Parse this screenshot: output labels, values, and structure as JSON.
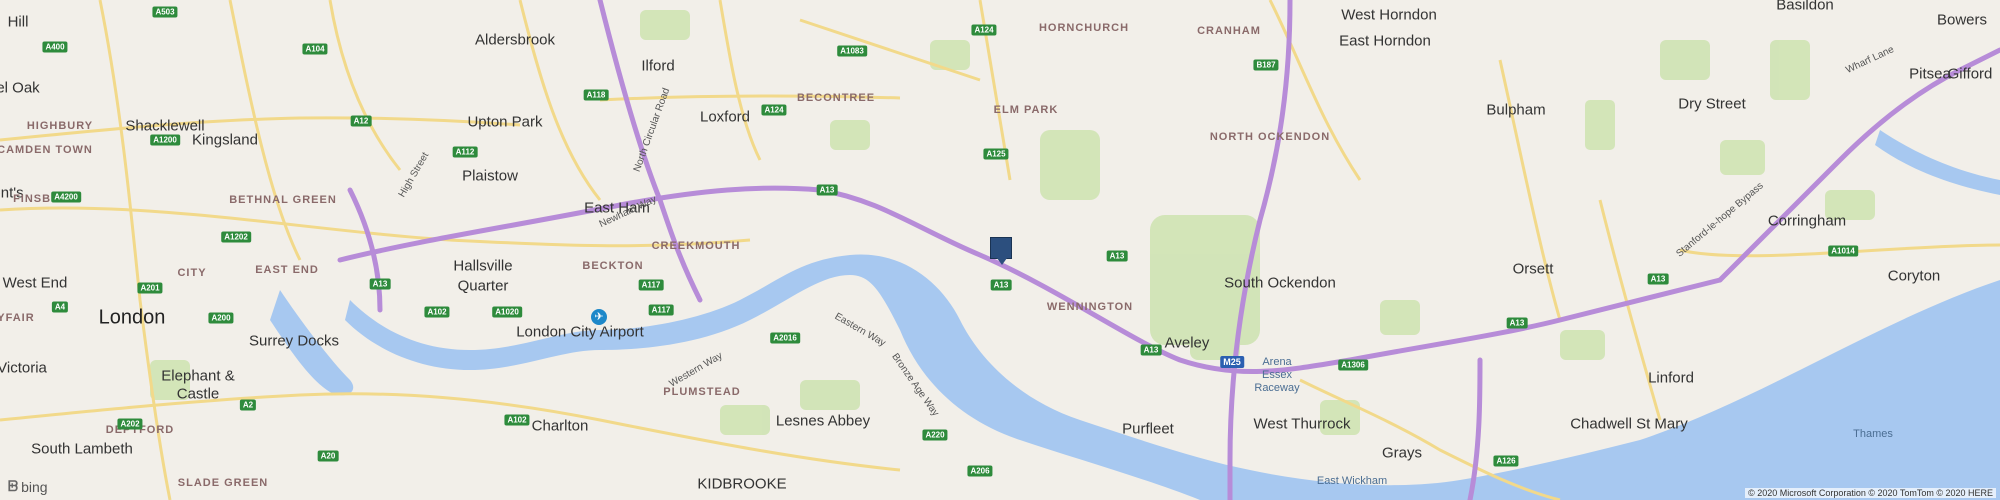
{
  "colors": {
    "land": "#f2efe9",
    "water": "#a7c8f0",
    "park": "#cfe3b3",
    "motorway": "#b78cd8",
    "primary_road": "#f2d98a",
    "pin": "#2c4f7e"
  },
  "pin": {
    "icon": "map-pin-square-icon"
  },
  "airport": {
    "icon": "airport-plane-icon",
    "glyph": "✈"
  },
  "places": [
    "Hill",
    "el Oak",
    "HIGHBURY",
    "Shacklewell",
    "Aldersbrook",
    "Ilford",
    "HORNCHURCH",
    "CRANHAM",
    "West Horndon",
    "East Horndon",
    "Basildon",
    "Bowers",
    "Gifford",
    "Pitsea",
    "CAMDEN TOWN",
    "Kingsland",
    "Upton Park",
    "Loxford",
    "BECONTREE",
    "ELM PARK",
    "NORTH OCKENDON",
    "Bulpham",
    "Dry Street",
    "ent's",
    "FINSBURY",
    "BETHNAL GREEN",
    "Plaistow",
    "East Ham",
    "CREEKMOUTH",
    "Corringham",
    "West End",
    "CITY",
    "EAST END",
    "Hallsville",
    "Quarter",
    "BECKTON",
    "WENNINGTON",
    "South Ockendon",
    "Orsett",
    "Coryton",
    "London",
    "AYFAIR",
    "Surrey Docks",
    "London City Airport",
    "Aveley",
    "Victoria",
    "Elephant &",
    "Castle",
    "PLUMSTEAD",
    "Lesnes Abbey",
    "Purfleet",
    "Linford",
    "Arena",
    "Essex",
    "Raceway",
    "Charlton",
    "DEPTFORD",
    "West Thurrock",
    "Grays",
    "Chadwell St Mary",
    "South Lambeth",
    "Thames",
    "East Wickham",
    "KIDBROOKE",
    "SLADE GREEN"
  ],
  "road_names": [
    "North Circular Road",
    "High Street",
    "Newham Way",
    "Western Way",
    "Eastern Way",
    "Bronze Age Way",
    "Stanford-le-hope Bypass",
    "Wharf Lane"
  ],
  "road_shields": [
    "A503",
    "A104",
    "A1083",
    "A124",
    "A400",
    "A118",
    "A12",
    "A1200",
    "A124",
    "B187",
    "A125",
    "A112",
    "A4200",
    "A13",
    "A1202",
    "A13",
    "A117",
    "A13",
    "A201",
    "A4",
    "A13",
    "A200",
    "A1020",
    "A102",
    "A117",
    "A2016",
    "A13",
    "A1306",
    "A13",
    "A1014",
    "M25",
    "A13",
    "A2",
    "A202",
    "A102",
    "A220",
    "A206",
    "A20",
    "A126"
  ],
  "brand": {
    "icon": "bing-logo-icon",
    "glyph": "ᗸ",
    "text": "bing"
  },
  "copyright": "© 2020 Microsoft Corporation © 2020 TomTom © 2020 HERE"
}
